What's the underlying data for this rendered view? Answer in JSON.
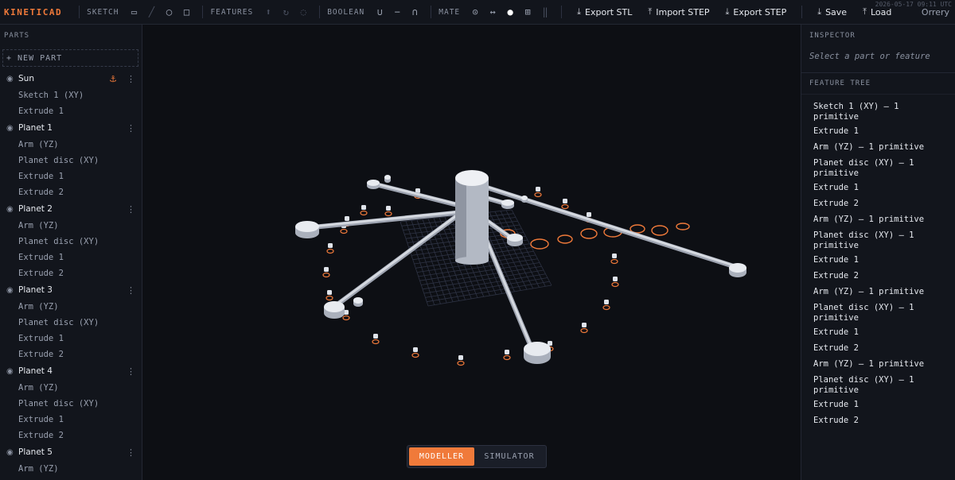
{
  "app": {
    "logo": "KINETICAD",
    "timestamp": "2026-05-17 09:11 UTC",
    "project_name": "Orrery"
  },
  "toolbar": {
    "sketch_label": "SKETCH",
    "features_label": "FEATURES",
    "boolean_label": "BOOLEAN",
    "mate_label": "MATE",
    "export_stl": "Export STL",
    "import_step": "Import STEP",
    "export_step": "Export STEP",
    "save": "Save",
    "load": "Load",
    "icons": {
      "sketch": [
        "rectangle-icon",
        "line-icon",
        "circle-icon",
        "square-icon"
      ],
      "features": [
        "extrude-icon",
        "revolve-icon",
        "fillet-icon"
      ],
      "boolean": [
        "union-icon",
        "subtract-icon",
        "intersect-icon"
      ],
      "mate": [
        "revolute-icon",
        "slider-icon",
        "fixed-icon",
        "grid-icon",
        "rigid-icon"
      ]
    },
    "glyphs": {
      "rect": "▭",
      "line": "╱",
      "circle": "◯",
      "square": "□",
      "extrude": "⬆",
      "revolve": "↻",
      "fillet": "◌",
      "union": "∪",
      "subtract": "−",
      "intersect": "∩",
      "revolute": "⊙",
      "slider": "↔",
      "fixed": "●",
      "grid": "⊞",
      "rigid": "‖",
      "download": "⤓",
      "upload": "⤒"
    }
  },
  "left_panel": {
    "title": "PARTS",
    "new_part": "+ NEW PART",
    "eye_glyph": "◉",
    "anchor_glyph": "⚓",
    "more_glyph": "⋮",
    "parts": [
      {
        "name": "Sun",
        "anchored": true,
        "children": [
          "Sketch 1 (XY)",
          "Extrude 1"
        ]
      },
      {
        "name": "Planet 1",
        "anchored": false,
        "children": [
          "Arm (YZ)",
          "Planet disc (XY)",
          "Extrude 1",
          "Extrude 2"
        ]
      },
      {
        "name": "Planet 2",
        "anchored": false,
        "children": [
          "Arm (YZ)",
          "Planet disc (XY)",
          "Extrude 1",
          "Extrude 2"
        ]
      },
      {
        "name": "Planet 3",
        "anchored": false,
        "children": [
          "Arm (YZ)",
          "Planet disc (XY)",
          "Extrude 1",
          "Extrude 2"
        ]
      },
      {
        "name": "Planet 4",
        "anchored": false,
        "children": [
          "Arm (YZ)",
          "Planet disc (XY)",
          "Extrude 1",
          "Extrude 2"
        ]
      },
      {
        "name": "Planet 5",
        "anchored": false,
        "children": [
          "Arm (YZ)"
        ]
      }
    ]
  },
  "viewport": {
    "modes": [
      "MODELLER",
      "SIMULATOR"
    ],
    "active_mode": "MODELLER",
    "accent": "#f07a3a"
  },
  "right_panel": {
    "inspector_title": "INSPECTOR",
    "inspector_hint": "Select a part or feature",
    "tree_title": "FEATURE TREE",
    "tree_items": [
      "Sketch 1 (XY) — 1 primitive",
      "Extrude 1",
      "Arm (YZ) — 1 primitive",
      "Planet disc (XY) — 1 primitive",
      "Extrude 1",
      "Extrude 2",
      "Arm (YZ) — 1 primitive",
      "Planet disc (XY) — 1 primitive",
      "Extrude 1",
      "Extrude 2",
      "Arm (YZ) — 1 primitive",
      "Planet disc (XY) — 1 primitive",
      "Extrude 1",
      "Extrude 2",
      "Arm (YZ) — 1 primitive",
      "Planet disc (XY) — 1 primitive",
      "Extrude 1",
      "Extrude 2"
    ]
  }
}
